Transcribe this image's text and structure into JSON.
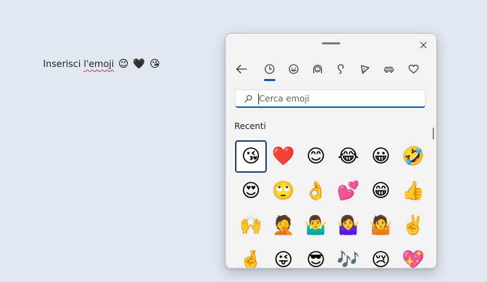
{
  "document": {
    "text_before": "Inserisci ",
    "misspelled_word": "l'emoji",
    "inline_emojis": [
      "😉",
      "🖤",
      "😘"
    ]
  },
  "emoji_panel": {
    "search": {
      "value": "",
      "placeholder": "Cerca emoji"
    },
    "section_label": "Recenti",
    "tabs": [
      {
        "icon": "clock-icon",
        "selected": true
      },
      {
        "icon": "smiley-icon",
        "selected": false
      },
      {
        "icon": "kaomoji-icon",
        "selected": false
      },
      {
        "icon": "symbols-icon",
        "selected": false
      },
      {
        "icon": "food-icon",
        "selected": false
      },
      {
        "icon": "car-icon",
        "selected": false
      },
      {
        "icon": "heart-icon",
        "selected": false
      }
    ],
    "emojis": [
      "😘",
      "❤️",
      "😊",
      "😂",
      "😀",
      "🤣",
      "😍",
      "🙄",
      "👌",
      "💕",
      "😁",
      "👍",
      "🙌",
      "🤦",
      "🤷‍♂️",
      "🤷‍♀️",
      "🤷",
      "✌️",
      "🤞",
      "😜",
      "😎",
      "🎶",
      "😢",
      "💖"
    ],
    "selected_index": 0,
    "accent_color": "#005fb8"
  }
}
